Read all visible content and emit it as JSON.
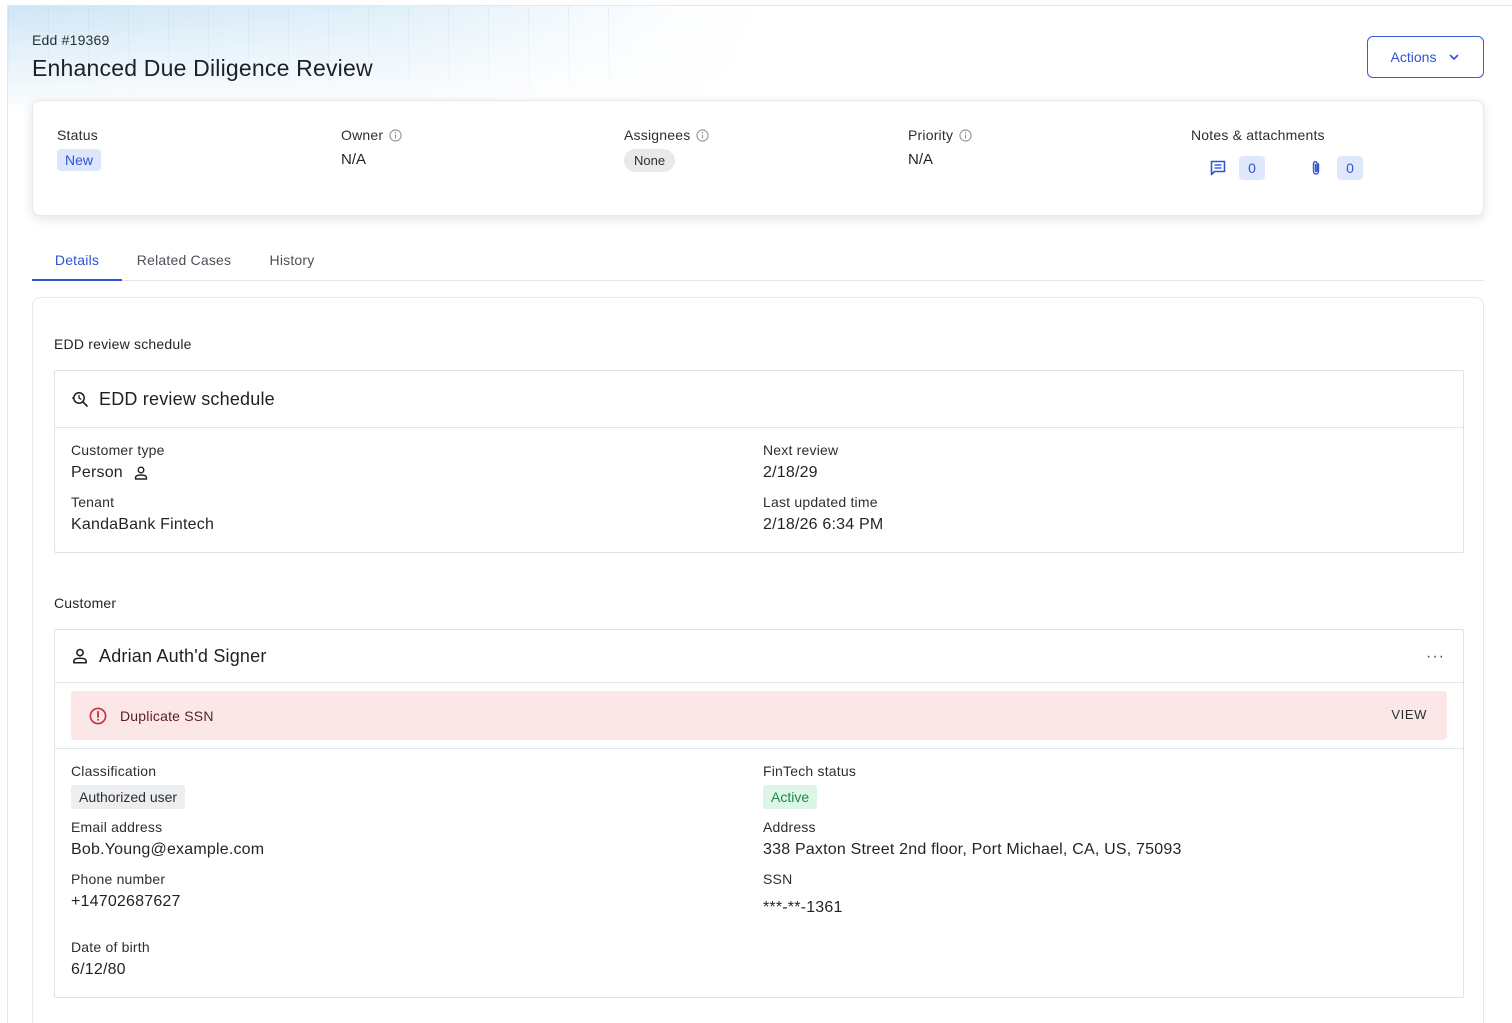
{
  "header": {
    "case_id": "Edd #19369",
    "title": "Enhanced Due Diligence Review",
    "actions_label": "Actions"
  },
  "summary": {
    "status": {
      "label": "Status",
      "value": "New"
    },
    "owner": {
      "label": "Owner",
      "value": "N/A"
    },
    "assignees": {
      "label": "Assignees",
      "value": "None"
    },
    "priority": {
      "label": "Priority",
      "value": "N/A"
    },
    "notes": {
      "label": "Notes & attachments",
      "notes_count": "0",
      "attachments_count": "0"
    }
  },
  "tabs": [
    {
      "label": "Details",
      "active": true
    },
    {
      "label": "Related Cases",
      "active": false
    },
    {
      "label": "History",
      "active": false
    }
  ],
  "schedule": {
    "section_title": "EDD review schedule",
    "panel_title": "EDD review schedule",
    "customer_type_label": "Customer type",
    "customer_type_value": "Person",
    "tenant_label": "Tenant",
    "tenant_value": "KandaBank Fintech",
    "next_review_label": "Next review",
    "next_review_value": "2/18/29",
    "last_updated_label": "Last updated time",
    "last_updated_value": "2/18/26 6:34 PM"
  },
  "customer": {
    "section_title": "Customer",
    "name": "Adrian Auth'd Signer",
    "more_label": "···",
    "alert_text": "Duplicate SSN",
    "alert_action": "VIEW",
    "classification_label": "Classification",
    "classification_value": "Authorized user",
    "email_label": "Email address",
    "email_value": "Bob.Young@example.com",
    "phone_label": "Phone number",
    "phone_value": "+14702687627",
    "dob_label": "Date of birth",
    "dob_value": "6/12/80",
    "fintech_status_label": "FinTech status",
    "fintech_status_value": "Active",
    "address_label": "Address",
    "address_value": "338 Paxton Street 2nd floor, Port Michael, CA, US, 75093",
    "ssn_label": "SSN",
    "ssn_value": "***-**-1361"
  },
  "colors": {
    "accent": "#2f54d6",
    "alert_bg": "#fbe7e8",
    "alert_icon": "#c62f3a",
    "active_green": "#1b8a4a"
  },
  "icons": {
    "actions_chevron": "chevron-down-icon",
    "info": "info-icon",
    "notes": "comment-icon",
    "attachments": "paperclip-icon",
    "schedule": "search-schedule-icon",
    "person": "person-icon",
    "alert": "alert-circle-icon"
  }
}
